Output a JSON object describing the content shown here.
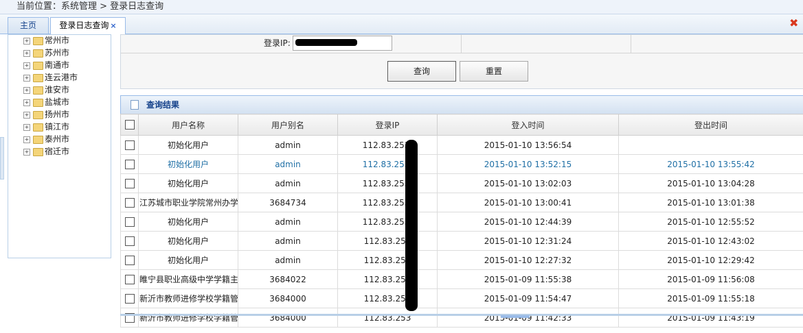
{
  "breadcrumb": {
    "text": "当前位置：系统管理 > 登录日志查询"
  },
  "tabs": {
    "home": "主页",
    "active": "登录日志查询",
    "close_glyph": "×"
  },
  "tree": {
    "items": [
      "常州市",
      "苏州市",
      "南通市",
      "连云港市",
      "淮安市",
      "盐城市",
      "扬州市",
      "镇江市",
      "泰州市",
      "宿迁市"
    ]
  },
  "form": {
    "ip_label": "登录IP:",
    "query_button": "查询",
    "reset_button": "重置"
  },
  "results": {
    "title": "查询结果",
    "columns": [
      "用户名称",
      "用户别名",
      "登录IP",
      "登入时间",
      "登出时间"
    ],
    "rows": [
      {
        "name": "初始化用户",
        "alias": "admin",
        "ip": "112.83.253.",
        "login": "2015-01-10 13:56:54",
        "logout": ""
      },
      {
        "name": "初始化用户",
        "alias": "admin",
        "ip": "112.83.253.",
        "login": "2015-01-10 13:52:15",
        "logout": "2015-01-10 13:55:42"
      },
      {
        "name": "初始化用户",
        "alias": "admin",
        "ip": "112.83.253.",
        "login": "2015-01-10 13:02:03",
        "logout": "2015-01-10 13:04:28"
      },
      {
        "name": "江苏城市职业学院常州办学",
        "alias": "3684734",
        "ip": "112.83.253.",
        "login": "2015-01-10 13:00:41",
        "logout": "2015-01-10 13:01:38"
      },
      {
        "name": "初始化用户",
        "alias": "admin",
        "ip": "112.83.253.",
        "login": "2015-01-10 12:44:39",
        "logout": "2015-01-10 12:55:52"
      },
      {
        "name": "初始化用户",
        "alias": "admin",
        "ip": "112.83.253",
        "login": "2015-01-10 12:31:24",
        "logout": "2015-01-10 12:43:02"
      },
      {
        "name": "初始化用户",
        "alias": "admin",
        "ip": "112.83.253",
        "login": "2015-01-10 12:27:32",
        "logout": "2015-01-10 12:29:42"
      },
      {
        "name": "睢宁县职业高级中学学籍主",
        "alias": "3684022",
        "ip": "112.83.253",
        "login": "2015-01-09 11:55:38",
        "logout": "2015-01-09 11:56:08"
      },
      {
        "name": "新沂市教师进修学校学籍管",
        "alias": "3684000",
        "ip": "112.83.253",
        "login": "2015-01-09 11:54:47",
        "logout": "2015-01-09 11:55:18"
      },
      {
        "name": "新沂市教师进修学校学籍管",
        "alias": "3684000",
        "ip": "112.83.253",
        "login": "2015-01-09 11:42:33",
        "logout": "2015-01-09 11:43:19"
      }
    ]
  },
  "colors": {
    "accent": "#15428b",
    "highlight_row_text": "#1f6fa5",
    "close_icon": "#d9381e"
  }
}
